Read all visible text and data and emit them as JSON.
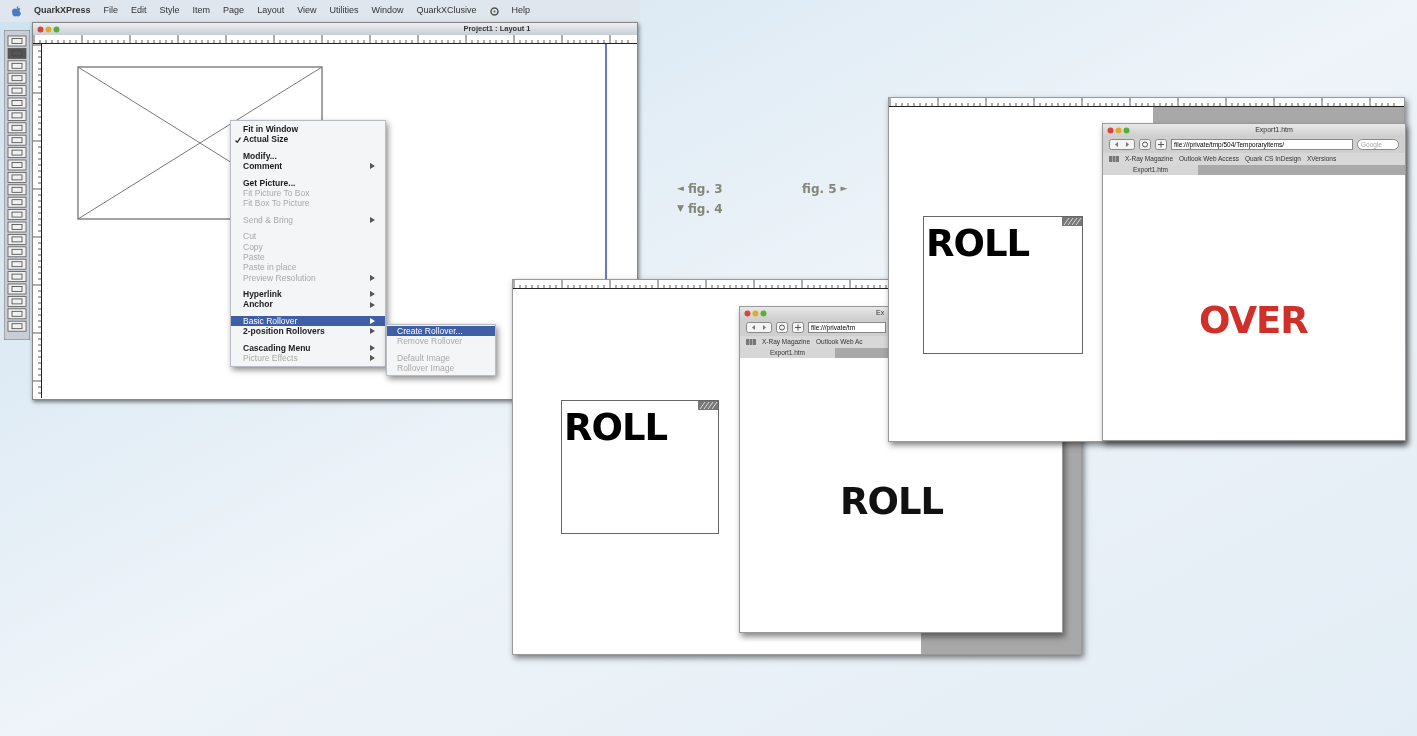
{
  "quark": {
    "menu_bar": {
      "items": [
        {
          "kind": "apple"
        },
        {
          "kind": "app",
          "label": "QuarkXPress"
        },
        {
          "kind": "text",
          "label": "File"
        },
        {
          "kind": "text",
          "label": "Edit"
        },
        {
          "kind": "text",
          "label": "Style"
        },
        {
          "kind": "text",
          "label": "Item"
        },
        {
          "kind": "text",
          "label": "Page"
        },
        {
          "kind": "text",
          "label": "Layout"
        },
        {
          "kind": "text",
          "label": "View"
        },
        {
          "kind": "text",
          "label": "Utilities"
        },
        {
          "kind": "text",
          "label": "Window"
        },
        {
          "kind": "text",
          "label": "QuarkXClusive"
        },
        {
          "kind": "script"
        },
        {
          "kind": "text",
          "label": "Help"
        }
      ]
    },
    "window": {
      "title": "Project1 : Layout 1"
    },
    "context_menu": {
      "items": [
        {
          "kind": "item",
          "label": "Fit in Window",
          "checked": false,
          "disabled": false,
          "submenu": false,
          "selected": false
        },
        {
          "kind": "item",
          "label": "Actual Size",
          "checked": true,
          "disabled": false,
          "submenu": false,
          "selected": false
        },
        {
          "kind": "separator"
        },
        {
          "kind": "item",
          "label": "Modify...",
          "checked": false,
          "disabled": false,
          "submenu": false,
          "selected": false
        },
        {
          "kind": "item",
          "label": "Comment",
          "checked": false,
          "disabled": false,
          "submenu": true,
          "selected": false
        },
        {
          "kind": "separator"
        },
        {
          "kind": "item",
          "label": "Get Picture...",
          "checked": false,
          "disabled": false,
          "submenu": false,
          "selected": false
        },
        {
          "kind": "item",
          "label": "Fit Picture To Box",
          "checked": false,
          "disabled": true,
          "submenu": false,
          "selected": false
        },
        {
          "kind": "item",
          "label": "Fit Box To Picture",
          "checked": false,
          "disabled": true,
          "submenu": false,
          "selected": false
        },
        {
          "kind": "separator"
        },
        {
          "kind": "item",
          "label": "Send & Bring",
          "checked": false,
          "disabled": true,
          "submenu": true,
          "selected": false
        },
        {
          "kind": "separator"
        },
        {
          "kind": "item",
          "label": "Cut",
          "checked": false,
          "disabled": true,
          "submenu": false,
          "selected": false
        },
        {
          "kind": "item",
          "label": "Copy",
          "checked": false,
          "disabled": true,
          "submenu": false,
          "selected": false
        },
        {
          "kind": "item",
          "label": "Paste",
          "checked": false,
          "disabled": true,
          "submenu": false,
          "selected": false
        },
        {
          "kind": "item",
          "label": "Paste in place",
          "checked": false,
          "disabled": true,
          "submenu": false,
          "selected": false
        },
        {
          "kind": "item",
          "label": "Preview Resolution",
          "checked": false,
          "disabled": true,
          "submenu": true,
          "selected": false
        },
        {
          "kind": "separator"
        },
        {
          "kind": "item",
          "label": "Hyperlink",
          "checked": false,
          "disabled": false,
          "submenu": true,
          "selected": false
        },
        {
          "kind": "item",
          "label": "Anchor",
          "checked": false,
          "disabled": false,
          "submenu": true,
          "selected": false
        },
        {
          "kind": "separator"
        },
        {
          "kind": "item",
          "label": "Basic Rollover",
          "checked": false,
          "disabled": false,
          "submenu": true,
          "selected": true
        },
        {
          "kind": "item",
          "label": "2-position Rollovers",
          "checked": false,
          "disabled": false,
          "submenu": true,
          "selected": false
        },
        {
          "kind": "separator"
        },
        {
          "kind": "item",
          "label": "Cascading Menu",
          "checked": false,
          "disabled": false,
          "submenu": true,
          "selected": false
        },
        {
          "kind": "item",
          "label": "Picture Effects",
          "checked": false,
          "disabled": true,
          "submenu": true,
          "selected": false
        }
      ]
    },
    "submenu": {
      "items": [
        {
          "kind": "item",
          "label": "Create Rollover...",
          "disabled": false,
          "selected": true
        },
        {
          "kind": "item",
          "label": "Remove Rollover",
          "disabled": true,
          "selected": false
        },
        {
          "kind": "separator"
        },
        {
          "kind": "item",
          "label": "Default Image",
          "disabled": true,
          "selected": false
        },
        {
          "kind": "item",
          "label": "Rollover Image",
          "disabled": true,
          "selected": false
        }
      ]
    }
  },
  "captions": [
    {
      "label": "fig. 3",
      "arrow_before": "◄"
    },
    {
      "label": "fig. 5",
      "arrow_after": "►"
    },
    {
      "label": "fig. 4",
      "arrow_before": "▼"
    }
  ],
  "figures": [
    {
      "layout_text": "ROLL",
      "browser": {
        "title": "Ex",
        "address": "file:///private/tm",
        "bookmarks": [
          "X-Ray Magazine",
          "Outlook Web Ac"
        ],
        "tab": "Export1.htm",
        "content": {
          "text": "ROLL",
          "color": "#111111"
        }
      }
    },
    {
      "layout_text": "ROLL",
      "browser": {
        "title": "Export1.htm",
        "address": "file:///private/tmp/504/Temporaryitems/",
        "search_placeholder": "Google",
        "bookmarks": [
          "X-Ray Magazine",
          "Outlook Web Access",
          "Quark CS InDesign",
          "XVersions"
        ],
        "tab": "Export1.htm",
        "content": {
          "text": "OVER",
          "color": "#d0302a"
        }
      }
    }
  ]
}
